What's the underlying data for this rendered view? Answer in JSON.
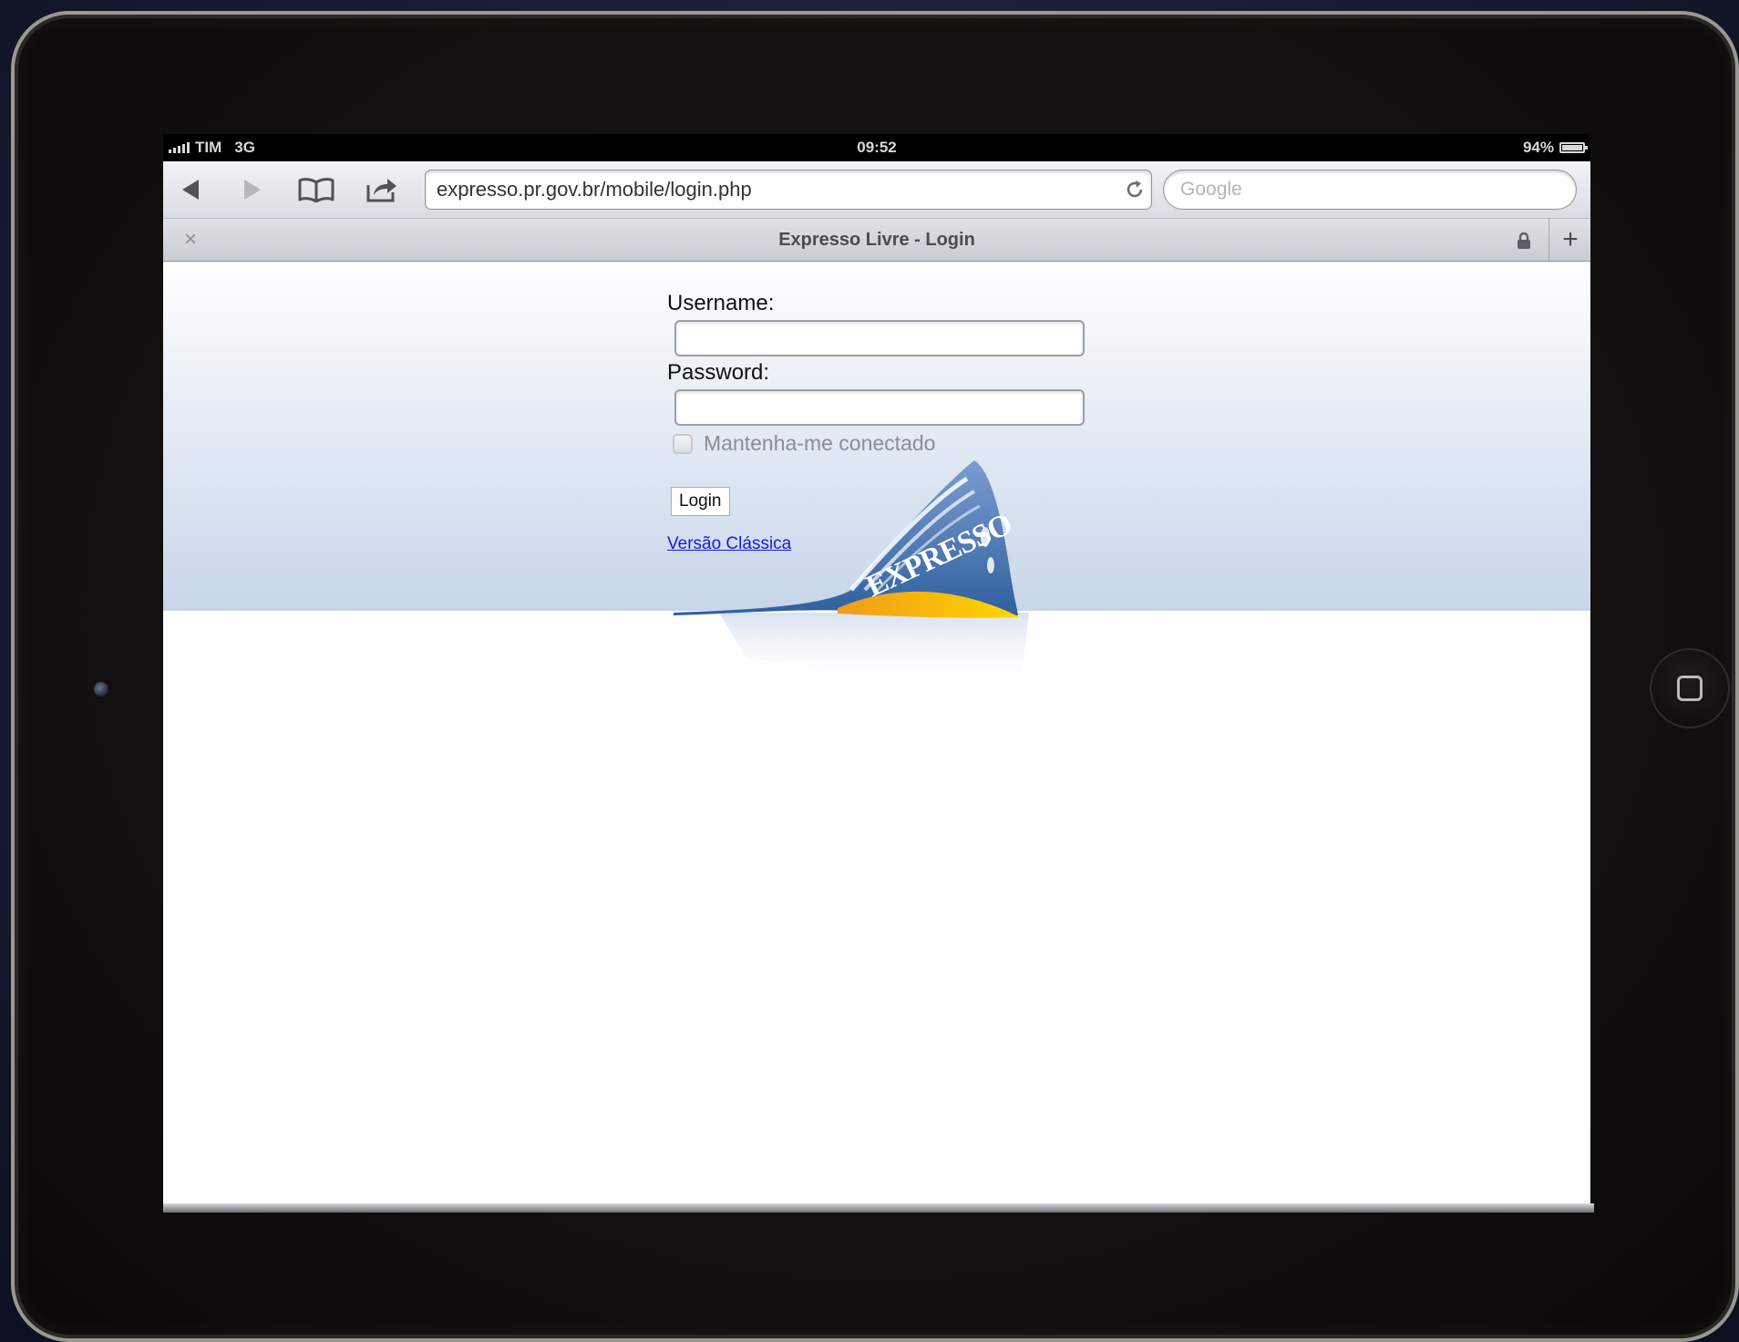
{
  "status_bar": {
    "carrier": "TIM",
    "network": "3G",
    "time": "09:52",
    "battery": "94%"
  },
  "browser": {
    "url": "expresso.pr.gov.br/mobile/login.php",
    "search_placeholder": "Google",
    "tab_title": "Expresso Livre - Login"
  },
  "form": {
    "username_label": "Username:",
    "password_label": "Password:",
    "remember_label": "Mantenha-me conectado",
    "login_button": "Login",
    "classic_link": "Versão Clássica"
  },
  "logo_text": "EXPRESSO",
  "colors": {
    "link": "#1a1ad8",
    "logo_blue": "#4c79b8",
    "logo_yellow": "#f5c400"
  }
}
